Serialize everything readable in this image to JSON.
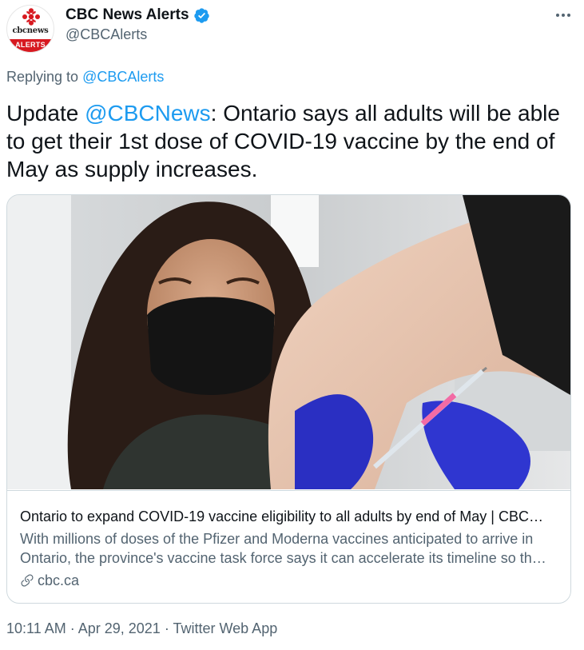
{
  "author": {
    "display_name": "CBC News Alerts",
    "handle": "@CBCAlerts",
    "avatar": {
      "brand_text": "cbcnews",
      "label": "ALERTS"
    },
    "verified_icon": "verified-badge-icon"
  },
  "reply": {
    "prefix": "Replying to",
    "mention": "@CBCAlerts"
  },
  "tweet": {
    "text_prefix": "Update ",
    "mention": "@CBCNews",
    "text_suffix": ": Ontario says all adults will be able to get their 1st dose of COVID-19 vaccine by the end of May as supply increases."
  },
  "card": {
    "title": "Ontario to expand COVID-19 vaccine eligibility to all adults by end of May | CBC…",
    "description": "With millions of doses of the Pfizer and Moderna vaccines anticipated to arrive in Ontario, the province's vaccine task force says it can accelerate its timeline so th…",
    "domain": "cbc.ca",
    "link_icon": "link-icon"
  },
  "meta": {
    "time": "10:11 AM",
    "date": "Apr 29, 2021",
    "source": "Twitter Web App",
    "separator": " · "
  },
  "colors": {
    "link": "#1d9bf0",
    "secondary_text": "#536471",
    "brand_red": "#d71920",
    "border": "#cfd9de"
  }
}
